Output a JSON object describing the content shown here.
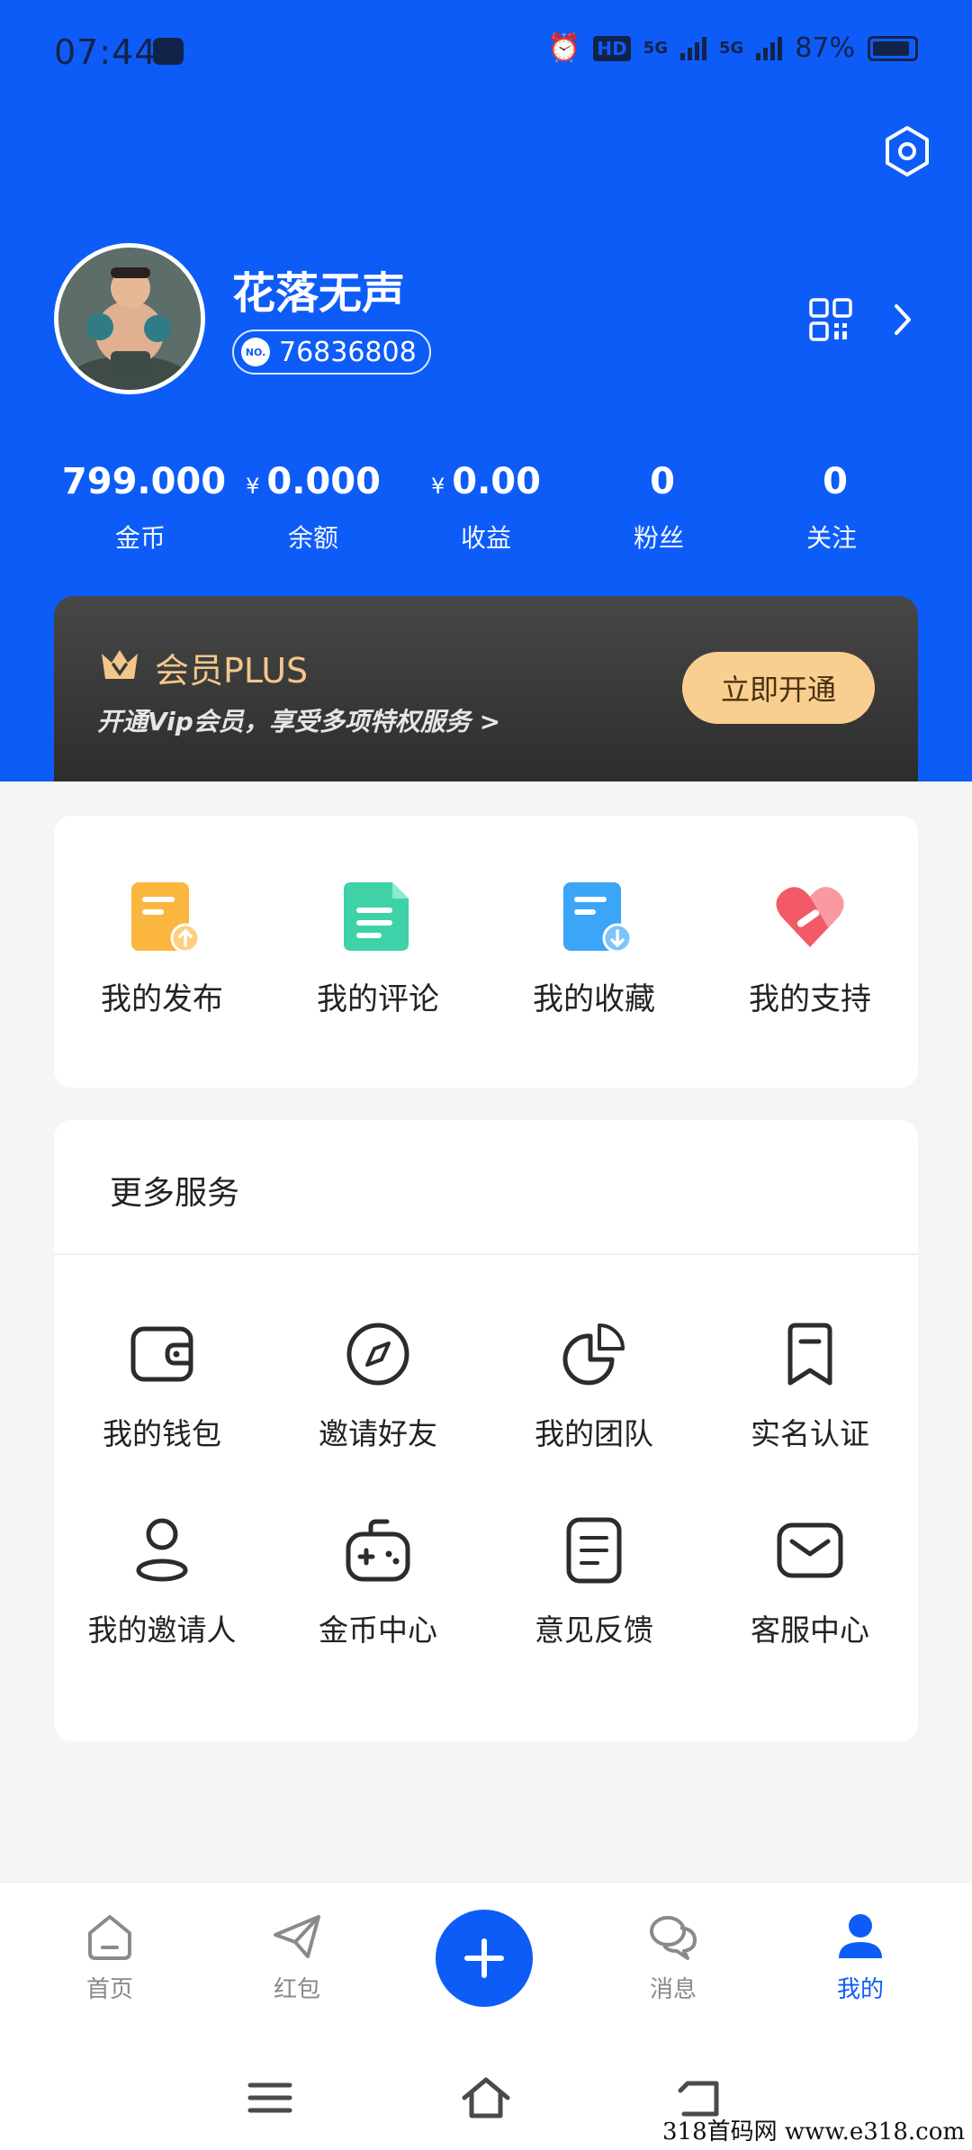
{
  "status_bar": {
    "time": "07:44",
    "battery": "87%",
    "network_1": "5G",
    "network_2": "5G",
    "hd": "HD"
  },
  "profile": {
    "username": "花落无声",
    "uid_prefix": "NO.",
    "uid": "76836808"
  },
  "stats": [
    {
      "currency": "",
      "value": "799.000",
      "label": "金币"
    },
    {
      "currency": "¥",
      "value": "0.000",
      "label": "余额"
    },
    {
      "currency": "¥",
      "value": "0.00",
      "label": "收益"
    },
    {
      "currency": "",
      "value": "0",
      "label": "粉丝"
    },
    {
      "currency": "",
      "value": "0",
      "label": "关注"
    }
  ],
  "vip": {
    "title": "会员PLUS",
    "subtitle": "开通Vip会员，享受多项特权服务 >",
    "button": "立即开通"
  },
  "quick_actions": [
    {
      "label": "我的发布",
      "icon": "publish-doc-icon",
      "color": "#fbb63f"
    },
    {
      "label": "我的评论",
      "icon": "comment-doc-icon",
      "color": "#3fd1a8"
    },
    {
      "label": "我的收藏",
      "icon": "favorite-doc-icon",
      "color": "#3ba5f7"
    },
    {
      "label": "我的支持",
      "icon": "heart-icon",
      "color": "#f25a67"
    }
  ],
  "services": {
    "title": "更多服务",
    "items": [
      {
        "label": "我的钱包",
        "icon": "wallet-icon"
      },
      {
        "label": "邀请好友",
        "icon": "compass-icon"
      },
      {
        "label": "我的团队",
        "icon": "pie-chart-icon"
      },
      {
        "label": "实名认证",
        "icon": "bookmark-icon"
      },
      {
        "label": "我的邀请人",
        "icon": "person-icon"
      },
      {
        "label": "金币中心",
        "icon": "gamepad-icon"
      },
      {
        "label": "意见反馈",
        "icon": "note-icon"
      },
      {
        "label": "客服中心",
        "icon": "mail-icon"
      }
    ]
  },
  "tabs": [
    {
      "label": "首页",
      "icon": "home-icon",
      "active": false
    },
    {
      "label": "红包",
      "icon": "paper-plane-icon",
      "active": false
    },
    {
      "label": "消息",
      "icon": "chat-icon",
      "active": false
    },
    {
      "label": "我的",
      "icon": "user-icon",
      "active": true
    }
  ],
  "accent_color": "#0e5cf8",
  "watermark": "318首码网 www.e318.com"
}
